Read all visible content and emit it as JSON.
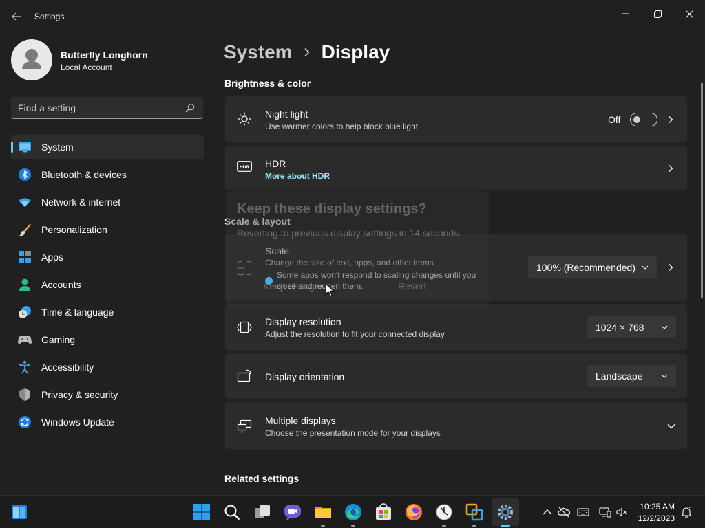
{
  "window": {
    "title": "Settings",
    "back_icon": "back-arrow-icon",
    "controls": [
      "minimize-icon",
      "maximize-icon",
      "close-icon"
    ]
  },
  "profile": {
    "name": "Butterfly Longhorn",
    "account_type": "Local Account"
  },
  "search": {
    "placeholder": "Find a setting",
    "value": ""
  },
  "sidebar": {
    "items": [
      {
        "label": "System",
        "icon": "system-monitor-icon",
        "active": true
      },
      {
        "label": "Bluetooth & devices",
        "icon": "bluetooth-icon"
      },
      {
        "label": "Network & internet",
        "icon": "wifi-icon"
      },
      {
        "label": "Personalization",
        "icon": "paintbrush-icon"
      },
      {
        "label": "Apps",
        "icon": "apps-icon"
      },
      {
        "label": "Accounts",
        "icon": "accounts-icon"
      },
      {
        "label": "Time & language",
        "icon": "clock-globe-icon"
      },
      {
        "label": "Gaming",
        "icon": "gamepad-icon"
      },
      {
        "label": "Accessibility",
        "icon": "accessibility-icon"
      },
      {
        "label": "Privacy & security",
        "icon": "shield-icon"
      },
      {
        "label": "Windows Update",
        "icon": "update-icon"
      }
    ]
  },
  "main": {
    "breadcrumb": {
      "parent": "System",
      "current": "Display"
    },
    "sections": {
      "brightness": "Brightness & color",
      "scale_layout": "Scale & layout",
      "related": "Related settings"
    },
    "night_light": {
      "title": "Night light",
      "subtitle": "Use warmer colors to help block blue light",
      "toggle_label": "Off",
      "toggle_on": false
    },
    "hdr": {
      "title": "HDR",
      "link": "More about HDR"
    },
    "scale": {
      "title": "Scale",
      "subtitle": "Change the size of text, apps, and other items",
      "value": "100% (Recommended)",
      "info": "Some apps won't respond to scaling changes until you close and reopen them."
    },
    "resolution": {
      "title": "Display resolution",
      "subtitle": "Adjust the resolution to fit your connected display",
      "value": "1024 × 768"
    },
    "orientation": {
      "title": "Display orientation",
      "value": "Landscape"
    },
    "multiple": {
      "title": "Multiple displays",
      "subtitle": "Choose the presentation mode for your displays"
    }
  },
  "dialog": {
    "title": "Keep these display settings?",
    "body": "Reverting to previous display settings in 14 seconds.",
    "keep_label": "Keep changes",
    "revert_label": "Revert"
  },
  "taskbar": {
    "apps": [
      "start-icon",
      "search-icon",
      "task-view-icon",
      "chat-icon",
      "file-explorer-icon",
      "edge-icon",
      "store-icon",
      "firefox-icon",
      "clock-app-icon",
      "vmware-icon",
      "settings-gear-icon"
    ],
    "tray": [
      "chevron-up-icon",
      "onedrive-icon",
      "keyboard-icon",
      "network-icon",
      "volume-mute-icon"
    ],
    "time": "10:25 AM",
    "date": "12/2/2023"
  },
  "colors": {
    "accent": "#60cdff",
    "background": "#202020",
    "card": "#2b2b2b",
    "link": "#99ebff"
  }
}
